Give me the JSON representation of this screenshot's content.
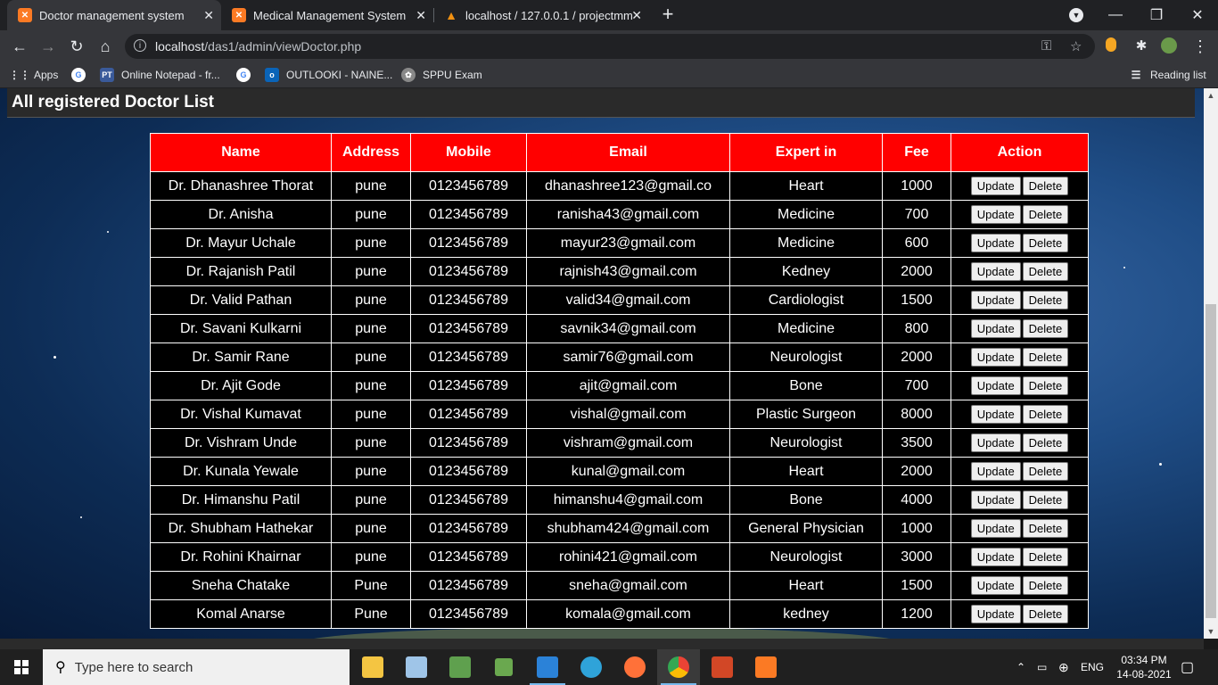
{
  "browser": {
    "tabs": [
      {
        "title": "Doctor management system",
        "active": true
      },
      {
        "title": "Medical Management System",
        "active": false
      },
      {
        "title": "localhost / 127.0.0.1 / projectmm",
        "active": false
      }
    ],
    "url_host": "localhost",
    "url_path": "/das1/admin/viewDoctor.php",
    "bookmarks": [
      "Apps",
      "Online Notepad - fr...",
      "OUTLOOKI - NAINE...",
      "SPPU Exam"
    ],
    "reading_list": "Reading list"
  },
  "page": {
    "title": "All registered Doctor List",
    "columns": [
      "Name",
      "Address",
      "Mobile",
      "Email",
      "Expert in",
      "Fee",
      "Action"
    ],
    "update_label": "Update",
    "delete_label": "Delete",
    "rows": [
      {
        "name": "Dr. Dhanashree Thorat",
        "address": "pune",
        "mobile": "0123456789",
        "email": "dhanashree123@gmail.co",
        "expert": "Heart",
        "fee": "1000"
      },
      {
        "name": "Dr. Anisha",
        "address": "pune",
        "mobile": "0123456789",
        "email": "ranisha43@gmail.com",
        "expert": "Medicine",
        "fee": "700"
      },
      {
        "name": "Dr. Mayur Uchale",
        "address": "pune",
        "mobile": "0123456789",
        "email": "mayur23@gmail.com",
        "expert": "Medicine",
        "fee": "600"
      },
      {
        "name": "Dr. Rajanish Patil",
        "address": "pune",
        "mobile": "0123456789",
        "email": "rajnish43@gmail.com",
        "expert": "Kedney",
        "fee": "2000"
      },
      {
        "name": "Dr. Valid Pathan",
        "address": "pune",
        "mobile": "0123456789",
        "email": "valid34@gmail.com",
        "expert": "Cardiologist",
        "fee": "1500"
      },
      {
        "name": "Dr. Savani Kulkarni",
        "address": "pune",
        "mobile": "0123456789",
        "email": "savnik34@gmail.com",
        "expert": "Medicine",
        "fee": "800"
      },
      {
        "name": "Dr. Samir Rane",
        "address": "pune",
        "mobile": "0123456789",
        "email": "samir76@gmail.com",
        "expert": "Neurologist",
        "fee": "2000"
      },
      {
        "name": "Dr. Ajit Gode",
        "address": "pune",
        "mobile": "0123456789",
        "email": "ajit@gmail.com",
        "expert": "Bone",
        "fee": "700"
      },
      {
        "name": "Dr. Vishal Kumavat",
        "address": "pune",
        "mobile": "0123456789",
        "email": "vishal@gmail.com",
        "expert": "Plastic Surgeon",
        "fee": "8000"
      },
      {
        "name": "Dr. Vishram Unde",
        "address": "pune",
        "mobile": "0123456789",
        "email": "vishram@gmail.com",
        "expert": "Neurologist",
        "fee": "3500"
      },
      {
        "name": "Dr. Kunala Yewale",
        "address": "pune",
        "mobile": "0123456789",
        "email": "kunal@gmail.com",
        "expert": "Heart",
        "fee": "2000"
      },
      {
        "name": "Dr. Himanshu Patil",
        "address": "pune",
        "mobile": "0123456789",
        "email": "himanshu4@gmail.com",
        "expert": "Bone",
        "fee": "4000"
      },
      {
        "name": "Dr. Shubham Hathekar",
        "address": "pune",
        "mobile": "0123456789",
        "email": "shubham424@gmail.com",
        "expert": "General Physician",
        "fee": "1000"
      },
      {
        "name": "Dr. Rohini Khairnar",
        "address": "pune",
        "mobile": "0123456789",
        "email": "rohini421@gmail.com",
        "expert": "Neurologist",
        "fee": "3000"
      },
      {
        "name": "Sneha Chatake",
        "address": "Pune",
        "mobile": "0123456789",
        "email": "sneha@gmail.com",
        "expert": "Heart",
        "fee": "1500"
      },
      {
        "name": "Komal Anarse",
        "address": "Pune",
        "mobile": "0123456789",
        "email": "komala@gmail.com",
        "expert": "kedney",
        "fee": "1200"
      }
    ]
  },
  "taskbar": {
    "search_placeholder": "Type here to search",
    "language": "ENG",
    "time": "03:34 PM",
    "date": "14-08-2021"
  },
  "colors": {
    "header_red": "#ff0000",
    "row_black": "#000000",
    "chrome_dark": "#202124"
  }
}
